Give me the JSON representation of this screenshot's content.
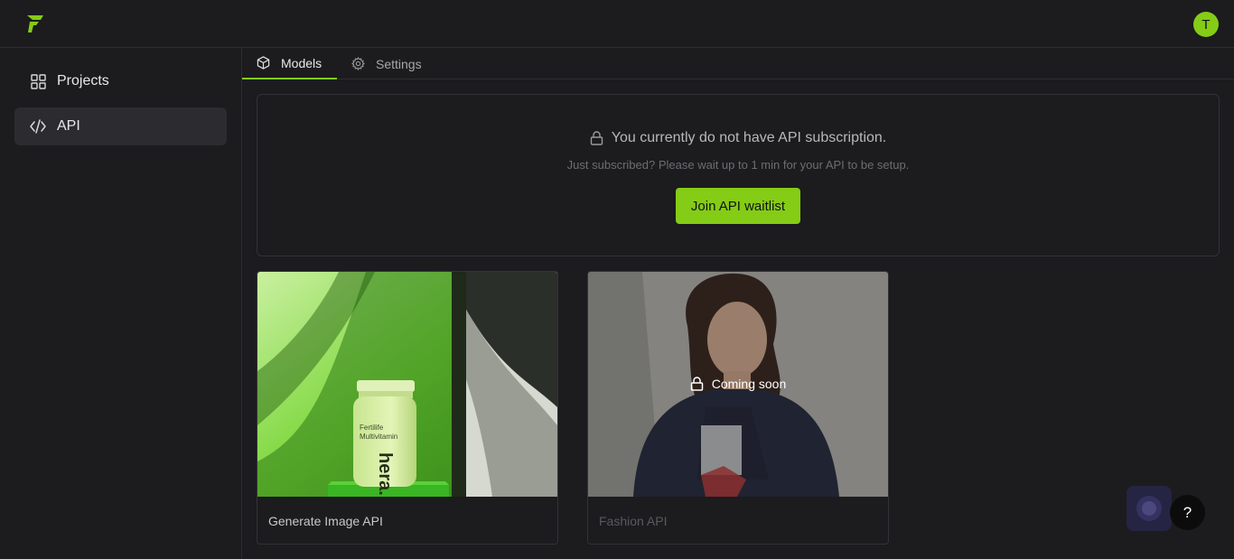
{
  "app": {
    "logo_icon": "lightning-f-logo-icon",
    "brand_color": "#84cc16",
    "avatar_initial": "T"
  },
  "sidebar": {
    "items": [
      {
        "label": "Projects",
        "icon": "grid-icon",
        "active": false
      },
      {
        "label": "API",
        "icon": "code-icon",
        "active": true
      }
    ]
  },
  "tabs": [
    {
      "label": "Models",
      "icon": "cube-icon",
      "active": true
    },
    {
      "label": "Settings",
      "icon": "gear-icon",
      "active": false
    }
  ],
  "notice": {
    "title": "You currently do not have API subscription.",
    "subtitle": "Just subscribed? Please wait up to 1 min for your API to be setup.",
    "button_label": "Join API waitlist",
    "icon": "lock-icon"
  },
  "cards": [
    {
      "label": "Generate Image API",
      "image": "green supplement bottle product photo",
      "locked": false
    },
    {
      "label": "Fashion API",
      "image": "woman in navy sweater photo",
      "locked": true,
      "overlay_text": "Coming soon",
      "overlay_icon": "lock-icon"
    }
  ],
  "help": {
    "label": "?"
  }
}
